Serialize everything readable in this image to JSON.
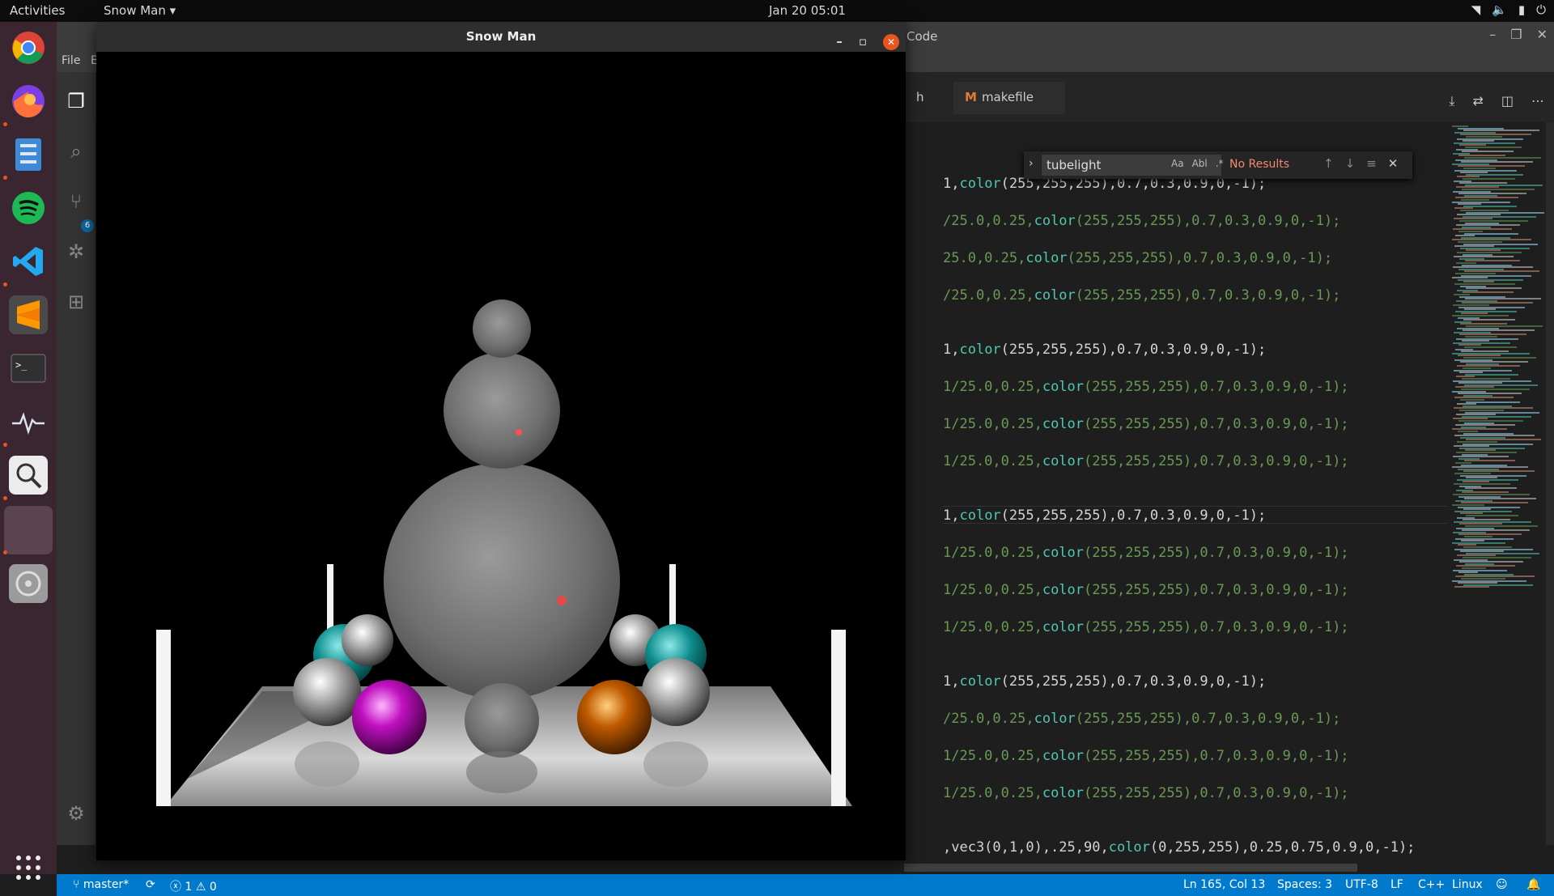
{
  "topbar": {
    "activities": "Activities",
    "app_menu": "Snow Man",
    "clock": "Jan 20  05:01",
    "tray": [
      "wifi-icon",
      "volume-icon",
      "battery-icon",
      "power-icon"
    ]
  },
  "dock": {
    "items": [
      "chrome-icon",
      "firefox-icon",
      "files-icon",
      "spotify-icon",
      "vscode-icon",
      "sublime-icon",
      "terminal-icon",
      "system-monitor-icon",
      "search-tool-icon",
      "active-window-icon",
      "disk-icon"
    ],
    "show_apps": "apps-grid-icon"
  },
  "vscode": {
    "title": "Code",
    "menu": [
      "File",
      "E"
    ],
    "tabs": [
      {
        "label": "h"
      },
      {
        "label": "makefile",
        "icon": "M"
      }
    ],
    "source_control_badge": "6",
    "find_widget": {
      "value": "tubelight",
      "options": [
        "Aa",
        "Abl",
        ".*"
      ],
      "result": "No Results"
    },
    "code_lines": [
      {
        "pre": "1,",
        "fn": "color",
        "args": "(255,255,255)",
        "post": ",0.7,0.3,0.9,0,-1);",
        "style": "white"
      },
      {
        "pre": "/25.0,0.25,",
        "fn": "color",
        "args": "(255,255,255)",
        "post": ",0.7,0.3,0.9,0,-1);",
        "style": "green"
      },
      {
        "pre": "25.0,0.25,",
        "fn": "color",
        "args": "(255,255,255)",
        "post": ",0.7,0.3,0.9,0,-1);",
        "style": "green"
      },
      {
        "pre": "/25.0,0.25,",
        "fn": "color",
        "args": "(255,255,255)",
        "post": ",0.7,0.3,0.9,0,-1);",
        "style": "green"
      },
      {
        "pre": "1,",
        "fn": "color",
        "args": "(255,255,255)",
        "post": ",0.7,0.3,0.9,0,-1);",
        "style": "white"
      },
      {
        "pre": "1/25.0,0.25,",
        "fn": "color",
        "args": "(255,255,255)",
        "post": ",0.7,0.3,0.9,0,-1);",
        "style": "green"
      },
      {
        "pre": "1/25.0,0.25,",
        "fn": "color",
        "args": "(255,255,255)",
        "post": ",0.7,0.3,0.9,0,-1);",
        "style": "green"
      },
      {
        "pre": "1/25.0,0.25,",
        "fn": "color",
        "args": "(255,255,255)",
        "post": ",0.7,0.3,0.9,0,-1);",
        "style": "green"
      },
      {
        "pre": "1,",
        "fn": "color",
        "args": "(255,255,255)",
        "post": ",0.7,0.3,0.9,0,-1);",
        "style": "white"
      },
      {
        "pre": "1/25.0,0.25,",
        "fn": "color",
        "args": "(255,255,255)",
        "post": ",0.7,0.3,0.9,0,-1);",
        "style": "green"
      },
      {
        "pre": "1/25.0,0.25,",
        "fn": "color",
        "args": "(255,255,255)",
        "post": ",0.7,0.3,0.9,0,-1);",
        "style": "green"
      },
      {
        "pre": "1/25.0,0.25,",
        "fn": "color",
        "args": "(255,255,255)",
        "post": ",0.7,0.3,0.9,0,-1);",
        "style": "green"
      },
      {
        "pre": "1,",
        "fn": "color",
        "args": "(255,255,255)",
        "post": ",0.7,0.3,0.9,0,-1);",
        "style": "white"
      },
      {
        "pre": "/25.0,0.25,",
        "fn": "color",
        "args": "(255,255,255)",
        "post": ",0.7,0.3,0.9,0,-1);",
        "style": "green"
      },
      {
        "pre": "1/25.0,0.25,",
        "fn": "color",
        "args": "(255,255,255)",
        "post": ",0.7,0.3,0.9,0,-1);",
        "style": "green"
      },
      {
        "pre": "1/25.0,0.25,",
        "fn": "color",
        "args": "(255,255,255)",
        "post": ",0.7,0.3,0.9,0,-1);",
        "style": "green"
      },
      {
        "pre": ",vec3(0,1,0),.25,90,",
        "fn": "color",
        "args": "(0,255,255)",
        "post": ",0.25,0.75,0.9,0,-1);",
        "style": "white"
      }
    ],
    "status": {
      "branch": "master*",
      "errors": "1",
      "warnings": "0",
      "position": "Ln 165, Col 13",
      "spaces": "Spaces: 3",
      "encoding": "UTF-8",
      "eol": "LF",
      "language": "C++",
      "platform": "Linux"
    }
  },
  "snowman_window": {
    "title": "Snow Man",
    "controls": [
      "minimize-icon",
      "maximize-icon",
      "close-icon"
    ]
  },
  "colors": {
    "accent": "#e95420",
    "status_bar": "#007acc",
    "string_green": "#6a9955",
    "function_teal": "#4ec9b0"
  }
}
